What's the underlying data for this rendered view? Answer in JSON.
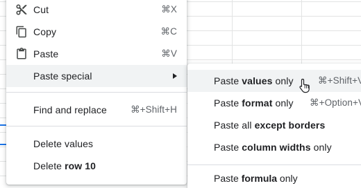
{
  "menu": {
    "items": [
      {
        "label": "Cut",
        "shortcut": "⌘X",
        "icon": "scissors-icon"
      },
      {
        "label": "Copy",
        "shortcut": "⌘C",
        "icon": "copy-icon"
      },
      {
        "label": "Paste",
        "shortcut": "⌘V",
        "icon": "clipboard-icon"
      },
      {
        "label": "Paste special",
        "icon": "submenu-arrow-icon"
      },
      {
        "label": "Find and replace",
        "shortcut": "⌘+Shift+H"
      },
      {
        "label": "Delete values"
      },
      {
        "label_prefix": "Delete ",
        "label_bold": "row 10"
      }
    ]
  },
  "submenu": {
    "items": [
      {
        "lead": "Paste ",
        "bold": "values",
        "trail": " only",
        "shortcut": "⌘+Shift+V"
      },
      {
        "lead": "Paste ",
        "bold": "format",
        "trail": " only",
        "shortcut": "⌘+Option+V"
      },
      {
        "lead": "Paste all ",
        "bold": "except borders",
        "trail": ""
      },
      {
        "lead": "Paste ",
        "bold": "column widths",
        "trail": " only"
      },
      {
        "lead": "Paste ",
        "bold": "formula",
        "trail": " only"
      }
    ]
  },
  "colors": {
    "hover": "#f1f3f4",
    "separator": "#dadce0",
    "selection_blue": "#1a73e8",
    "text": "#202124",
    "shortcut": "#5f6368"
  }
}
